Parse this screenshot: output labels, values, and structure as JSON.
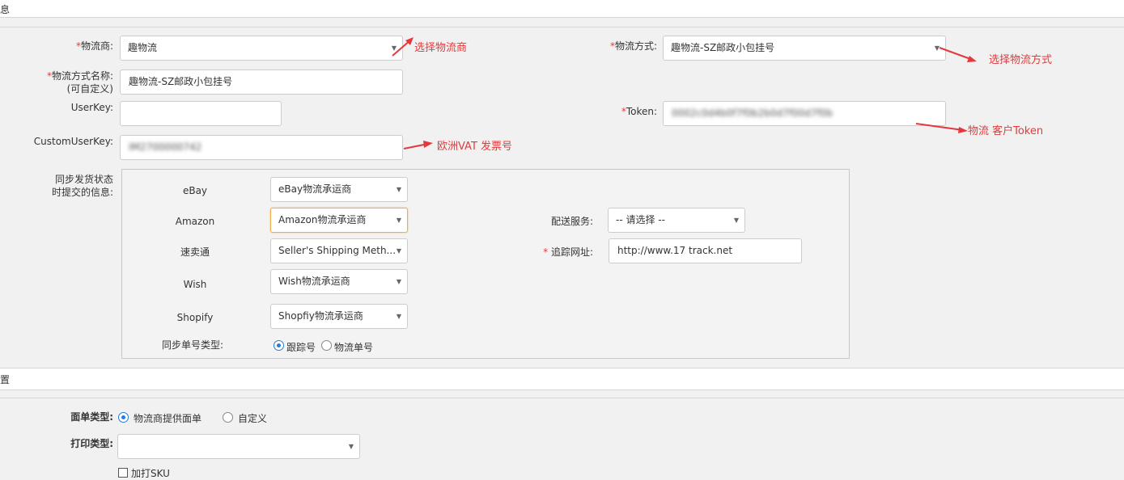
{
  "section1": {
    "title": "息"
  },
  "carrier": {
    "label": "物流商:",
    "value": "趣物流",
    "annotation": "选择物流商"
  },
  "method": {
    "label": "物流方式:",
    "value": "趣物流-SZ邮政小包挂号",
    "annotation": "选择物流方式"
  },
  "method_name": {
    "label_line1": "物流方式名称:",
    "label_line2": "(可自定义)",
    "value": "趣物流-SZ邮政小包挂号"
  },
  "userkey": {
    "label": "UserKey:",
    "value": ""
  },
  "token": {
    "label": "Token:",
    "value": "0002c0d4b0f7f0b2b0d7f00d7f0b",
    "annotation": "物流 客户Token"
  },
  "custom_userkey": {
    "label": "CustomUserKey:",
    "value": "IM2700000742",
    "annotation": "欧洲VAT 发票号"
  },
  "sync_panel": {
    "label_line1": "同步发货状态",
    "label_line2": "时提交的信息:",
    "rows": [
      {
        "platform": "eBay",
        "value": "eBay物流承运商"
      },
      {
        "platform": "Amazon",
        "value": "Amazon物流承运商"
      },
      {
        "platform": "速卖通",
        "value": "Seller's Shipping Meth..."
      },
      {
        "platform": "Wish",
        "value": "Wish物流承运商"
      },
      {
        "platform": "Shopify",
        "value": "Shopfiy物流承运商"
      }
    ],
    "delivery_service": {
      "label": "配送服务:",
      "value": "-- 请选择 --"
    },
    "tracking_url": {
      "label": "追踪网址:",
      "value": "http://www.17 track.net"
    },
    "sync_type": {
      "label": "同步单号类型:",
      "options": [
        "跟踪号",
        "物流单号"
      ],
      "selected": 0
    }
  },
  "section2": {
    "title": "置"
  },
  "label_type": {
    "label": "面单类型:",
    "options": [
      "物流商提供面单",
      "自定义"
    ],
    "selected": 0
  },
  "print_type": {
    "label": "打印类型:",
    "value": ""
  },
  "print_sku": {
    "label": "加打SKU",
    "checked": false
  },
  "colors": {
    "accent": "#2a7bd4",
    "annotation": "#e4393c",
    "focus": "#f0ad4e"
  }
}
